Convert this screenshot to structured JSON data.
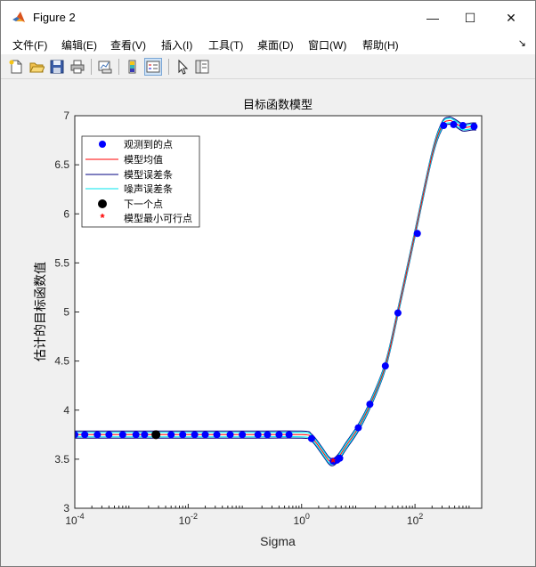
{
  "window": {
    "title": "Figure 2",
    "minimize_glyph": "—",
    "maximize_glyph": "☐",
    "close_glyph": "✕"
  },
  "menu": {
    "items": [
      "文件(F)",
      "编辑(E)",
      "查看(V)",
      "插入(I)",
      "工具(T)",
      "桌面(D)",
      "窗口(W)",
      "帮助(H)"
    ],
    "overflow_glyph": "↘"
  },
  "toolbar": {
    "icons": [
      "new-figure-icon",
      "open-file-icon",
      "save-icon",
      "print-icon",
      "link-plot-icon",
      "insert-colorbar-icon",
      "insert-legend-icon",
      "pointer-icon",
      "property-editor-icon"
    ]
  },
  "colors": {
    "observed": "#0000ff",
    "mean": "#ff0000",
    "model_error": "#000080",
    "noise_error": "#00e5ee",
    "next_point": "#000000",
    "min_feasible": "#ff0000"
  },
  "chart_data": {
    "type": "line",
    "title": "目标函数模型",
    "xlabel": "Sigma",
    "ylabel": "估计的目标函数值",
    "xscale": "log",
    "xlim": [
      0.0001,
      1500
    ],
    "ylim": [
      3,
      7
    ],
    "xticks": [
      {
        "value": 0.0001,
        "base": "10",
        "exp": "-4"
      },
      {
        "value": 0.01,
        "base": "10",
        "exp": "-2"
      },
      {
        "value": 1,
        "base": "10",
        "exp": "0"
      },
      {
        "value": 100,
        "base": "10",
        "exp": "2"
      }
    ],
    "yticks": [
      "3",
      "3.5",
      "4",
      "4.5",
      "5",
      "5.5",
      "6",
      "6.5",
      "7"
    ],
    "legend": {
      "placement": "top-left",
      "entries": [
        "观测到的点",
        "模型均值",
        "模型误差条",
        "噪声误差条",
        "下一个点",
        "模型最小可行点"
      ]
    },
    "series": [
      {
        "name": "模型均值",
        "x": [
          0.0001,
          0.001,
          0.01,
          0.1,
          1,
          1.5,
          2.2,
          3,
          3.6,
          4.5,
          6,
          10,
          16,
          30,
          50,
          100,
          200,
          300,
          400,
          500,
          700,
          1000,
          1200
        ],
        "y": [
          3.75,
          3.75,
          3.75,
          3.75,
          3.75,
          3.72,
          3.6,
          3.49,
          3.47,
          3.52,
          3.63,
          3.82,
          4.05,
          4.45,
          5.0,
          5.8,
          6.6,
          6.9,
          6.95,
          6.93,
          6.88,
          6.89,
          6.89
        ]
      },
      {
        "name": "观测到的点",
        "x": [
          0.0001,
          0.00015,
          0.00025,
          0.0004,
          0.0007,
          0.0012,
          0.0017,
          0.005,
          0.008,
          0.013,
          0.02,
          0.032,
          0.055,
          0.09,
          0.17,
          0.25,
          0.4,
          0.6,
          1.5,
          3.6,
          4.2,
          4.7,
          10,
          16,
          30,
          50,
          110,
          320,
          480,
          700,
          1100
        ],
        "y": [
          3.75,
          3.75,
          3.75,
          3.75,
          3.75,
          3.75,
          3.75,
          3.75,
          3.75,
          3.75,
          3.75,
          3.75,
          3.75,
          3.75,
          3.75,
          3.75,
          3.75,
          3.75,
          3.71,
          3.48,
          3.49,
          3.51,
          3.82,
          4.06,
          4.45,
          4.99,
          5.8,
          6.9,
          6.91,
          6.9,
          6.89
        ]
      },
      {
        "name": "下一个点",
        "x": [
          0.0027
        ],
        "y": [
          3.75
        ]
      },
      {
        "name": "模型最小可行点",
        "x": [
          3.6
        ],
        "y": [
          3.47
        ]
      }
    ]
  }
}
